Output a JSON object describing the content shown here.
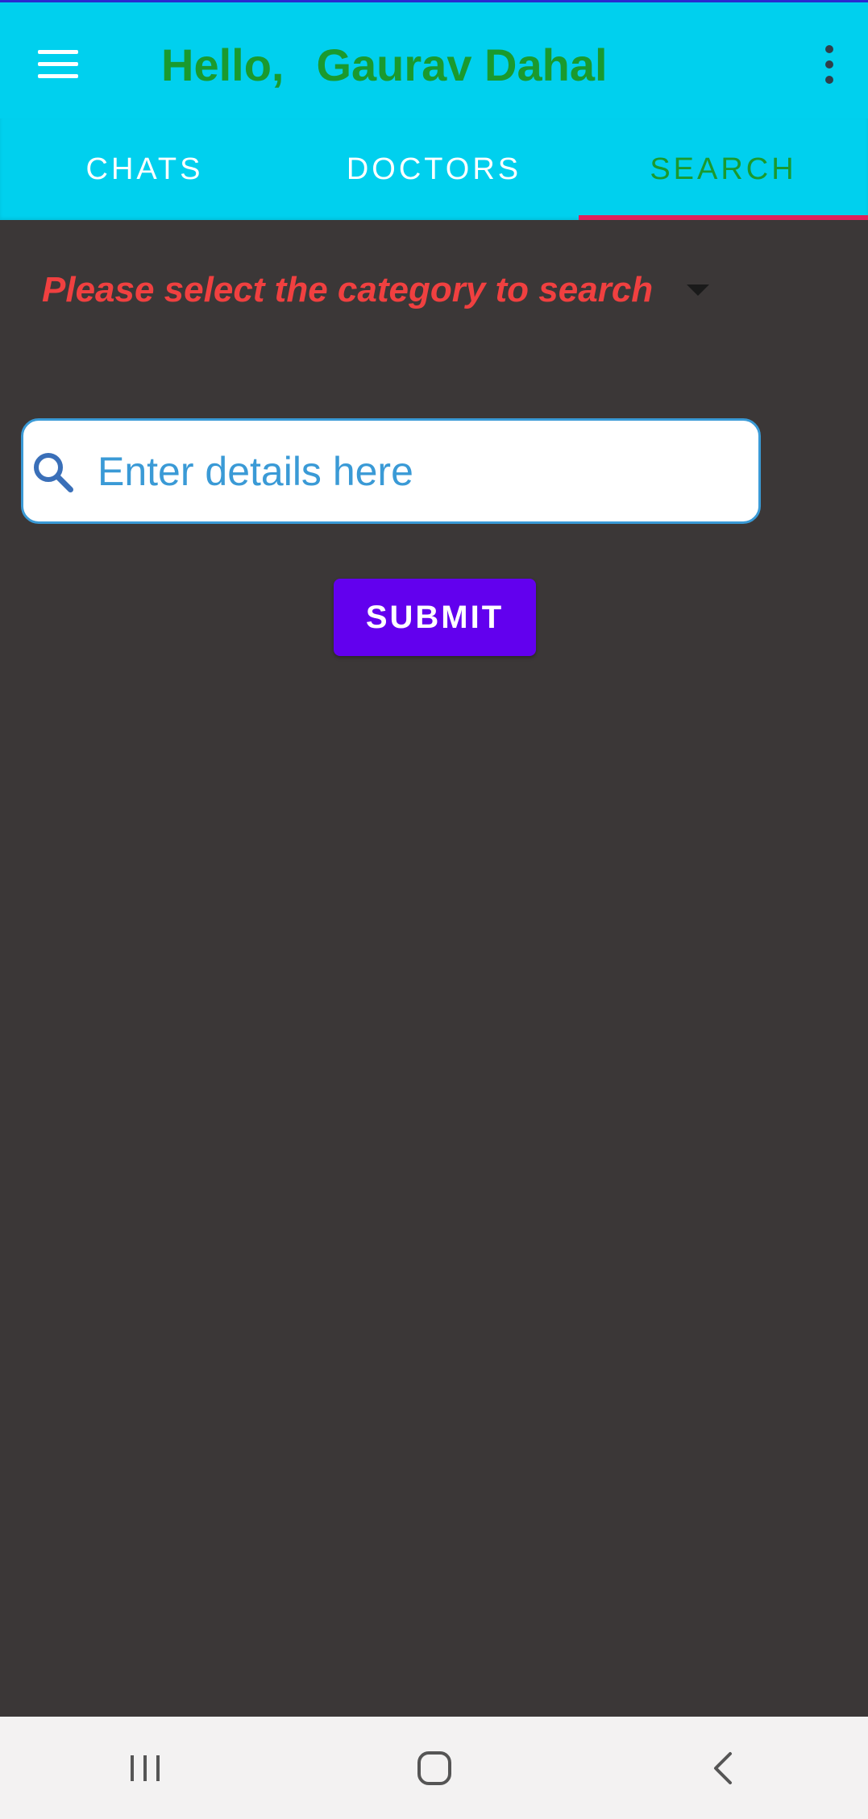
{
  "app_bar": {
    "greeting": "Hello,",
    "user_name": "Gaurav Dahal"
  },
  "tabs": [
    {
      "label": "CHATS",
      "active": false
    },
    {
      "label": "DOCTORS",
      "active": false
    },
    {
      "label": "SEARCH",
      "active": true
    }
  ],
  "search": {
    "category_prompt": "Please select the category to search",
    "placeholder": "Enter details here",
    "value": "",
    "submit_label": "SUBMIT"
  },
  "icons": {
    "menu": "menu-icon",
    "overflow": "more-vert-icon",
    "dropdown": "arrow-drop-down-icon",
    "search": "search-icon",
    "recents": "recents-icon",
    "home": "home-icon",
    "back": "back-icon"
  },
  "colors": {
    "app_bar": "#00d0ee",
    "title_text": "#1a9a2e",
    "tab_indicator": "#e0205a",
    "background": "#3b3737",
    "category_text": "#f04040",
    "submit_button": "#6200ee",
    "input_text": "#3a9ad6"
  }
}
